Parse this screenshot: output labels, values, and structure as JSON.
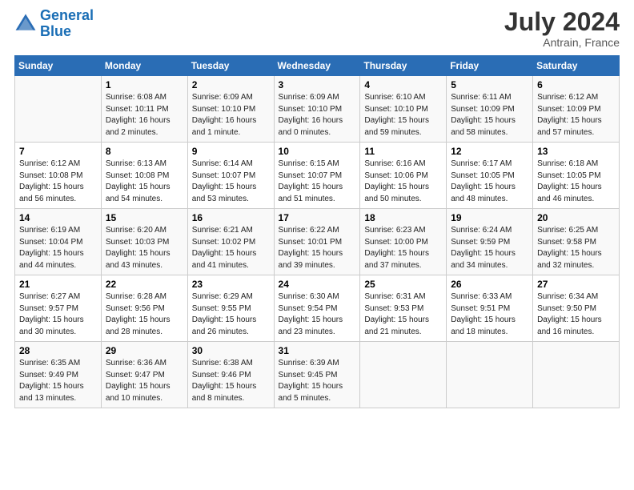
{
  "header": {
    "logo_line1": "General",
    "logo_line2": "Blue",
    "month": "July 2024",
    "location": "Antrain, France"
  },
  "days_of_week": [
    "Sunday",
    "Monday",
    "Tuesday",
    "Wednesday",
    "Thursday",
    "Friday",
    "Saturday"
  ],
  "weeks": [
    [
      {
        "day": "",
        "info": ""
      },
      {
        "day": "1",
        "info": "Sunrise: 6:08 AM\nSunset: 10:11 PM\nDaylight: 16 hours\nand 2 minutes."
      },
      {
        "day": "2",
        "info": "Sunrise: 6:09 AM\nSunset: 10:10 PM\nDaylight: 16 hours\nand 1 minute."
      },
      {
        "day": "3",
        "info": "Sunrise: 6:09 AM\nSunset: 10:10 PM\nDaylight: 16 hours\nand 0 minutes."
      },
      {
        "day": "4",
        "info": "Sunrise: 6:10 AM\nSunset: 10:10 PM\nDaylight: 15 hours\nand 59 minutes."
      },
      {
        "day": "5",
        "info": "Sunrise: 6:11 AM\nSunset: 10:09 PM\nDaylight: 15 hours\nand 58 minutes."
      },
      {
        "day": "6",
        "info": "Sunrise: 6:12 AM\nSunset: 10:09 PM\nDaylight: 15 hours\nand 57 minutes."
      }
    ],
    [
      {
        "day": "7",
        "info": "Sunrise: 6:12 AM\nSunset: 10:08 PM\nDaylight: 15 hours\nand 56 minutes."
      },
      {
        "day": "8",
        "info": "Sunrise: 6:13 AM\nSunset: 10:08 PM\nDaylight: 15 hours\nand 54 minutes."
      },
      {
        "day": "9",
        "info": "Sunrise: 6:14 AM\nSunset: 10:07 PM\nDaylight: 15 hours\nand 53 minutes."
      },
      {
        "day": "10",
        "info": "Sunrise: 6:15 AM\nSunset: 10:07 PM\nDaylight: 15 hours\nand 51 minutes."
      },
      {
        "day": "11",
        "info": "Sunrise: 6:16 AM\nSunset: 10:06 PM\nDaylight: 15 hours\nand 50 minutes."
      },
      {
        "day": "12",
        "info": "Sunrise: 6:17 AM\nSunset: 10:05 PM\nDaylight: 15 hours\nand 48 minutes."
      },
      {
        "day": "13",
        "info": "Sunrise: 6:18 AM\nSunset: 10:05 PM\nDaylight: 15 hours\nand 46 minutes."
      }
    ],
    [
      {
        "day": "14",
        "info": "Sunrise: 6:19 AM\nSunset: 10:04 PM\nDaylight: 15 hours\nand 44 minutes."
      },
      {
        "day": "15",
        "info": "Sunrise: 6:20 AM\nSunset: 10:03 PM\nDaylight: 15 hours\nand 43 minutes."
      },
      {
        "day": "16",
        "info": "Sunrise: 6:21 AM\nSunset: 10:02 PM\nDaylight: 15 hours\nand 41 minutes."
      },
      {
        "day": "17",
        "info": "Sunrise: 6:22 AM\nSunset: 10:01 PM\nDaylight: 15 hours\nand 39 minutes."
      },
      {
        "day": "18",
        "info": "Sunrise: 6:23 AM\nSunset: 10:00 PM\nDaylight: 15 hours\nand 37 minutes."
      },
      {
        "day": "19",
        "info": "Sunrise: 6:24 AM\nSunset: 9:59 PM\nDaylight: 15 hours\nand 34 minutes."
      },
      {
        "day": "20",
        "info": "Sunrise: 6:25 AM\nSunset: 9:58 PM\nDaylight: 15 hours\nand 32 minutes."
      }
    ],
    [
      {
        "day": "21",
        "info": "Sunrise: 6:27 AM\nSunset: 9:57 PM\nDaylight: 15 hours\nand 30 minutes."
      },
      {
        "day": "22",
        "info": "Sunrise: 6:28 AM\nSunset: 9:56 PM\nDaylight: 15 hours\nand 28 minutes."
      },
      {
        "day": "23",
        "info": "Sunrise: 6:29 AM\nSunset: 9:55 PM\nDaylight: 15 hours\nand 26 minutes."
      },
      {
        "day": "24",
        "info": "Sunrise: 6:30 AM\nSunset: 9:54 PM\nDaylight: 15 hours\nand 23 minutes."
      },
      {
        "day": "25",
        "info": "Sunrise: 6:31 AM\nSunset: 9:53 PM\nDaylight: 15 hours\nand 21 minutes."
      },
      {
        "day": "26",
        "info": "Sunrise: 6:33 AM\nSunset: 9:51 PM\nDaylight: 15 hours\nand 18 minutes."
      },
      {
        "day": "27",
        "info": "Sunrise: 6:34 AM\nSunset: 9:50 PM\nDaylight: 15 hours\nand 16 minutes."
      }
    ],
    [
      {
        "day": "28",
        "info": "Sunrise: 6:35 AM\nSunset: 9:49 PM\nDaylight: 15 hours\nand 13 minutes."
      },
      {
        "day": "29",
        "info": "Sunrise: 6:36 AM\nSunset: 9:47 PM\nDaylight: 15 hours\nand 10 minutes."
      },
      {
        "day": "30",
        "info": "Sunrise: 6:38 AM\nSunset: 9:46 PM\nDaylight: 15 hours\nand 8 minutes."
      },
      {
        "day": "31",
        "info": "Sunrise: 6:39 AM\nSunset: 9:45 PM\nDaylight: 15 hours\nand 5 minutes."
      },
      {
        "day": "",
        "info": ""
      },
      {
        "day": "",
        "info": ""
      },
      {
        "day": "",
        "info": ""
      }
    ]
  ]
}
